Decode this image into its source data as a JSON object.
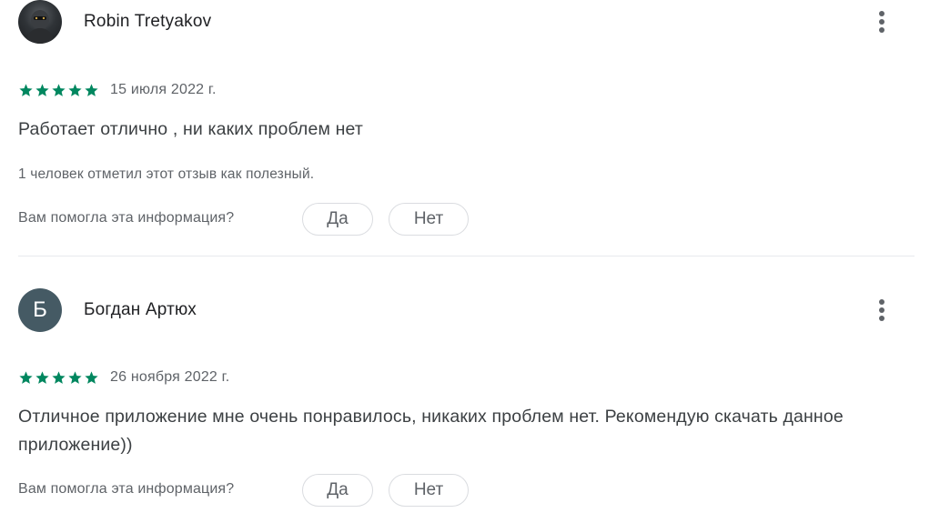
{
  "reviews": [
    {
      "author": "Robin Tretyakov",
      "avatar": {
        "type": "photo",
        "icon": "user-photo"
      },
      "rating": 5,
      "rating_max": 5,
      "date": "15 июля 2022 г.",
      "text": "Работает отлично , ни каких проблем нет",
      "helpful_count_text": "1 человек отметил этот отзыв как полезный.",
      "helpful_question": "Вам помогла эта информация?",
      "yes_label": "Да",
      "no_label": "Нет"
    },
    {
      "author": "Богдан Артюх",
      "avatar": {
        "type": "letter",
        "letter": "Б",
        "color": "#455a64"
      },
      "rating": 5,
      "rating_max": 5,
      "date": "26 ноября 2022 г.",
      "text": "Отличное приложение мне очень понравилось, никаких проблем нет. Рекомендую скачать данное приложение))",
      "helpful_question": "Вам помогла эта информация?",
      "yes_label": "Да",
      "no_label": "Нет"
    }
  ],
  "icons": {
    "star": "star-icon",
    "more": "more-vert-icon"
  },
  "colors": {
    "star": "#01875f",
    "text_primary": "#202124",
    "text_secondary": "#5f6368",
    "avatar_letter_bg": "#455a64",
    "divider": "#e8eaed",
    "pill_border": "#dadce0"
  }
}
